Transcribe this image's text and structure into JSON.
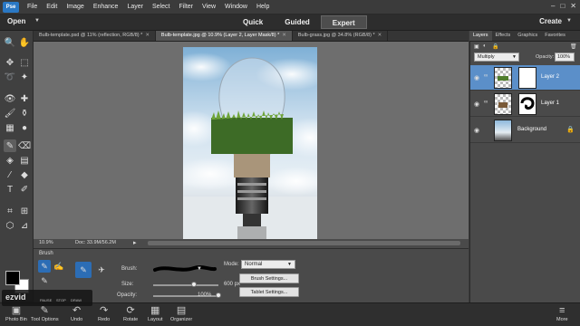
{
  "menubar": {
    "logo": "Pse",
    "items": [
      "File",
      "Edit",
      "Image",
      "Enhance",
      "Layer",
      "Select",
      "Filter",
      "View",
      "Window",
      "Help"
    ],
    "controls": [
      "–",
      "□",
      "✕"
    ]
  },
  "modebar": {
    "open_label": "Open",
    "modes": [
      "Quick",
      "Guided",
      "Expert"
    ],
    "active_mode": "Expert",
    "create_label": "Create"
  },
  "tabs": [
    {
      "label": "Bulb-template.psd @ 11% (reflection, RGB/8) *",
      "active": false
    },
    {
      "label": "Bulb-template.jpg @ 10.9% (Layer 2, Layer Mask/8) *",
      "active": true
    },
    {
      "label": "Bulb-grass.jpg @ 34.8% (RGB/8) *",
      "active": false
    }
  ],
  "status": {
    "zoom": "10.9%",
    "doc": "Doc: 33.9M/56.2M"
  },
  "options": {
    "title": "Brush",
    "brush_label": "Brush:",
    "size_label": "Size:",
    "size_value": "600 px",
    "size_fraction": 0.62,
    "opacity_label": "Opacity:",
    "opacity_value": "100%",
    "opacity_fraction": 1.0,
    "mode_label": "Mode:",
    "mode_value": "Normal",
    "brush_settings": "Brush Settings...",
    "tablet_settings": "Tablet Settings..."
  },
  "panel": {
    "tabs": [
      "Layers",
      "Effects",
      "Graphics",
      "Favorites"
    ],
    "active_tab": "Layers",
    "blend_mode": "Multiply",
    "opacity_label": "Opacity:",
    "opacity_value": "100%",
    "layers": [
      {
        "name": "Layer 2",
        "selected": true
      },
      {
        "name": "Layer 1",
        "selected": false
      },
      {
        "name": "Background",
        "selected": false
      }
    ]
  },
  "bottombar": {
    "items": [
      {
        "label": "Photo Bin",
        "icon": "photo-bin-icon"
      },
      {
        "label": "Tool Options",
        "icon": "tool-options-icon"
      },
      {
        "label": "Undo",
        "icon": "undo-icon"
      },
      {
        "label": "Redo",
        "icon": "redo-icon"
      },
      {
        "label": "Rotate",
        "icon": "rotate-icon"
      },
      {
        "label": "Layout",
        "icon": "layout-icon"
      },
      {
        "label": "Organizer",
        "icon": "organizer-icon"
      }
    ],
    "more_label": "More"
  },
  "watermark": {
    "text": "ezvid",
    "sub": [
      "PAUSE",
      "STOP",
      "DRAW"
    ]
  }
}
